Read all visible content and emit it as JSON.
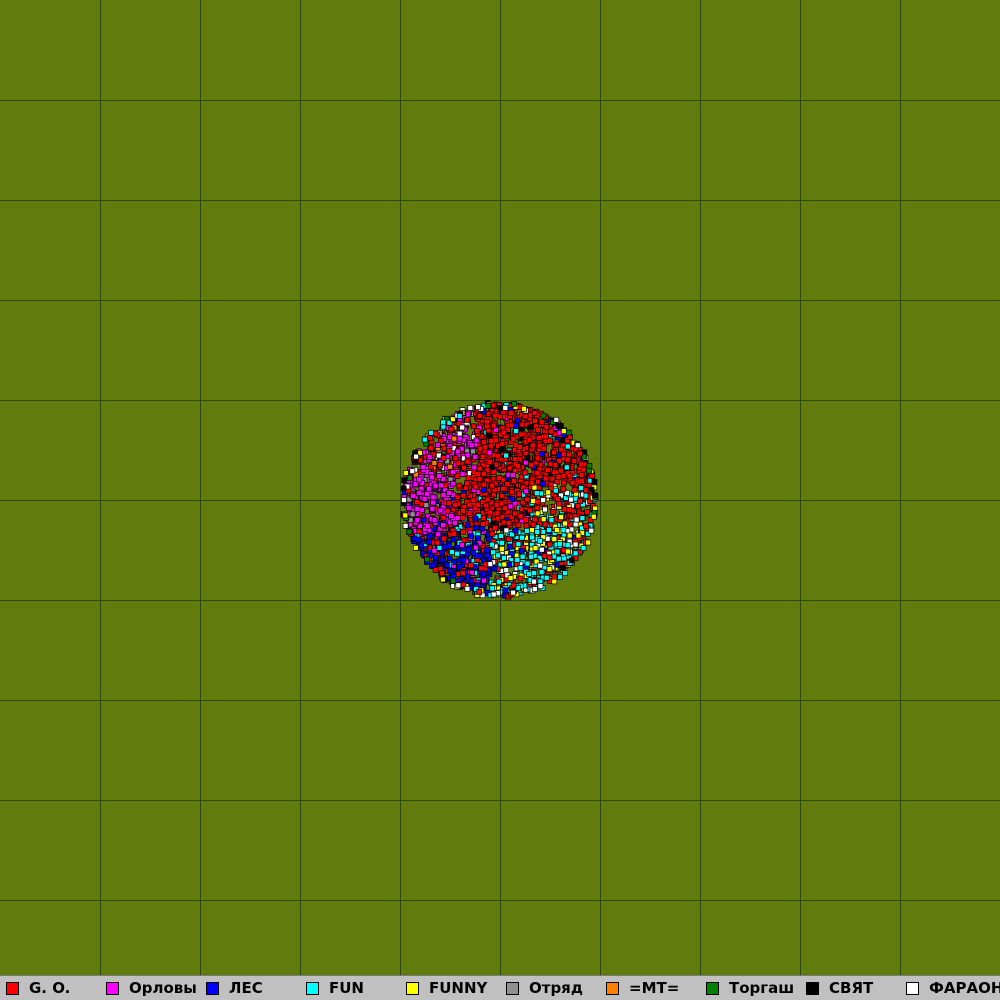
{
  "map": {
    "background_color": "#617b0c",
    "grid_color": "#2d4a14",
    "grid_divisions": 10
  },
  "legend": {
    "items": [
      {
        "label": "G. O.",
        "color": "#ff0000"
      },
      {
        "label": "Орловы",
        "color": "#ff00ff"
      },
      {
        "label": "ЛЕС",
        "color": "#0000ff"
      },
      {
        "label": "FUN",
        "color": "#00ffff"
      },
      {
        "label": "FUNNY",
        "color": "#ffff00"
      },
      {
        "label": "Отряд",
        "color": "#909090"
      },
      {
        "label": "=MT=",
        "color": "#ff8000"
      },
      {
        "label": "Торгаш",
        "color": "#008000"
      },
      {
        "label": "СВЯТ",
        "color": "#000000"
      },
      {
        "label": "ФАРАОН",
        "color": "#ffffff"
      }
    ]
  }
}
